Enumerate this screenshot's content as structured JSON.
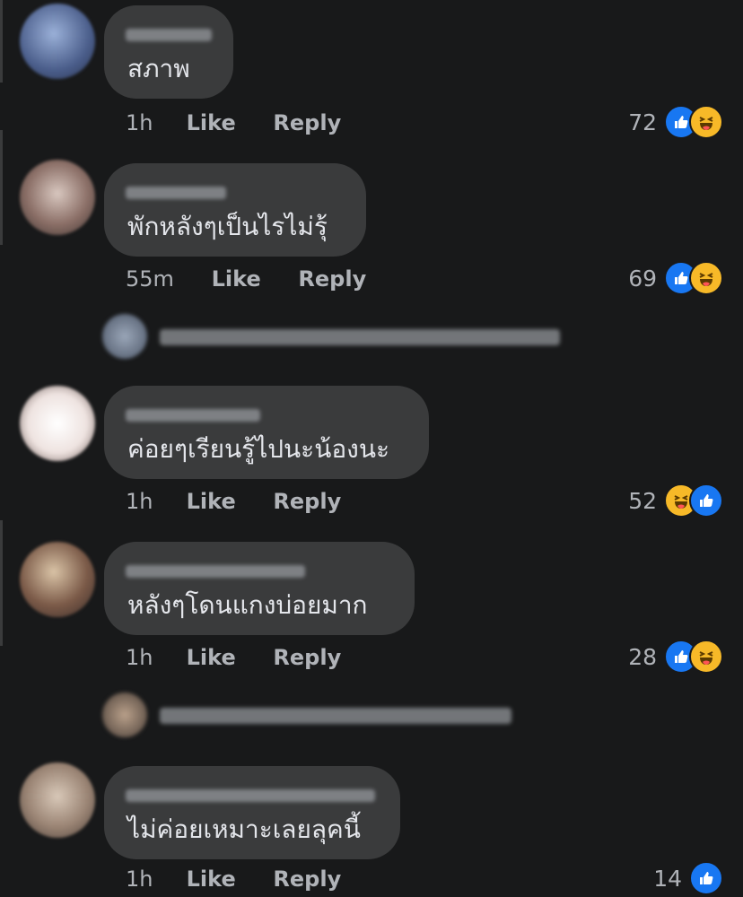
{
  "comments": [
    {
      "text": "สภาพ",
      "time": "1h",
      "like_label": "Like",
      "reply_label": "Reply",
      "reaction_count": "72",
      "reactions": [
        "like",
        "haha"
      ]
    },
    {
      "text": "พักหลังๆเป็นไรไม่รุ้",
      "time": "55m",
      "like_label": "Like",
      "reply_label": "Reply",
      "reaction_count": "69",
      "reactions": [
        "like",
        "haha"
      ]
    },
    {
      "text": "ค่อยๆเรียนรู้ไปนะน้องนะ",
      "time": "1h",
      "like_label": "Like",
      "reply_label": "Reply",
      "reaction_count": "52",
      "reactions": [
        "haha",
        "like"
      ]
    },
    {
      "text": "หลังๆโดนแกงบ่อยมาก",
      "time": "1h",
      "like_label": "Like",
      "reply_label": "Reply",
      "reaction_count": "28",
      "reactions": [
        "like",
        "haha"
      ]
    },
    {
      "text": "ไม่ค่อยเหมาะเลยลุคนี้",
      "time": "1h",
      "like_label": "Like",
      "reply_label": "Reply",
      "reaction_count": "14",
      "reactions": [
        "like"
      ]
    }
  ],
  "colors": {
    "background": "#18191a",
    "bubble": "#3a3b3c",
    "text": "#e4e6eb",
    "meta": "#b0b3b8",
    "like_blue": "#1877f2",
    "haha_yellow": "#f7b928"
  }
}
